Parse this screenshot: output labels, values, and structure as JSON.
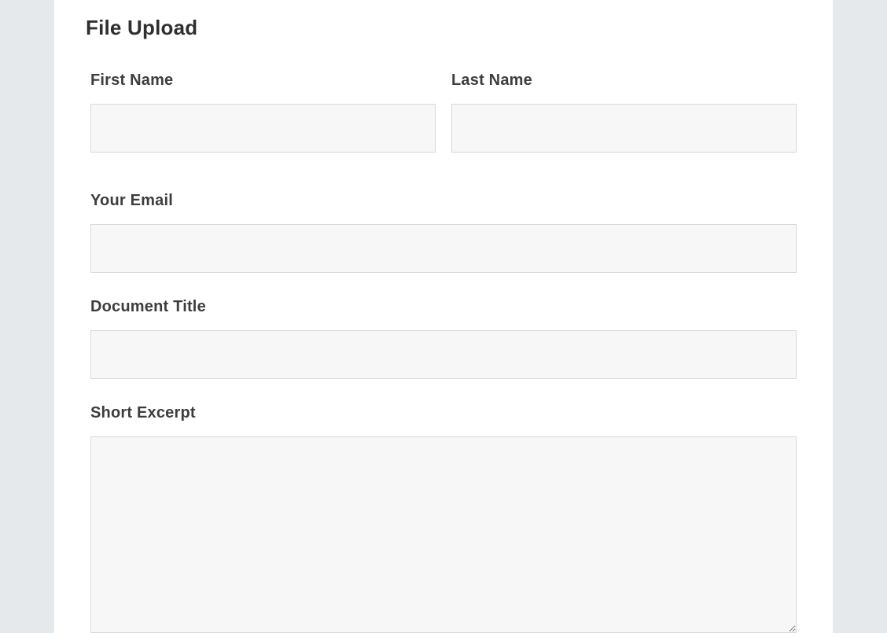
{
  "page": {
    "title": "File Upload"
  },
  "form": {
    "first_name": {
      "label": "First Name",
      "value": ""
    },
    "last_name": {
      "label": "Last Name",
      "value": ""
    },
    "email": {
      "label": "Your Email",
      "value": ""
    },
    "document_title": {
      "label": "Document Title",
      "value": ""
    },
    "short_excerpt": {
      "label": "Short Excerpt",
      "value": ""
    }
  }
}
